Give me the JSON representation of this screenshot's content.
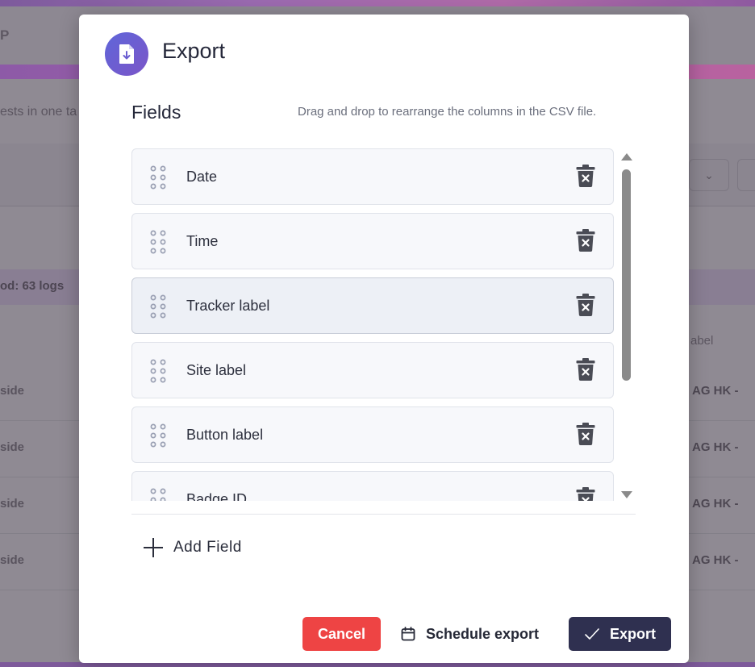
{
  "background": {
    "header_text": "P",
    "description_text": "ests in one ta",
    "period_text": "od: 63 logs",
    "table_header": "abel",
    "row_left_text": "side",
    "row_right_text": "AG HK -"
  },
  "modal": {
    "title": "Export",
    "icon": "file-download-icon",
    "fields_heading": "Fields",
    "fields_hint": "Drag and drop to rearrange the columns in the CSV file.",
    "fields": [
      {
        "label": "Date"
      },
      {
        "label": "Time"
      },
      {
        "label": "Tracker label"
      },
      {
        "label": "Site label"
      },
      {
        "label": "Button label"
      },
      {
        "label": "Badge ID"
      }
    ],
    "active_field_index": 2,
    "add_field_label": "Add Field",
    "buttons": {
      "cancel": "Cancel",
      "schedule": "Schedule export",
      "export": "Export"
    }
  },
  "colors": {
    "cancel": "#ee4444",
    "export": "#2f3050",
    "icon_gradient_start": "#5f66d9",
    "icon_gradient_end": "#7b55c8",
    "handle_dots": "#9aa0b3",
    "trash": "#4a4c55"
  }
}
